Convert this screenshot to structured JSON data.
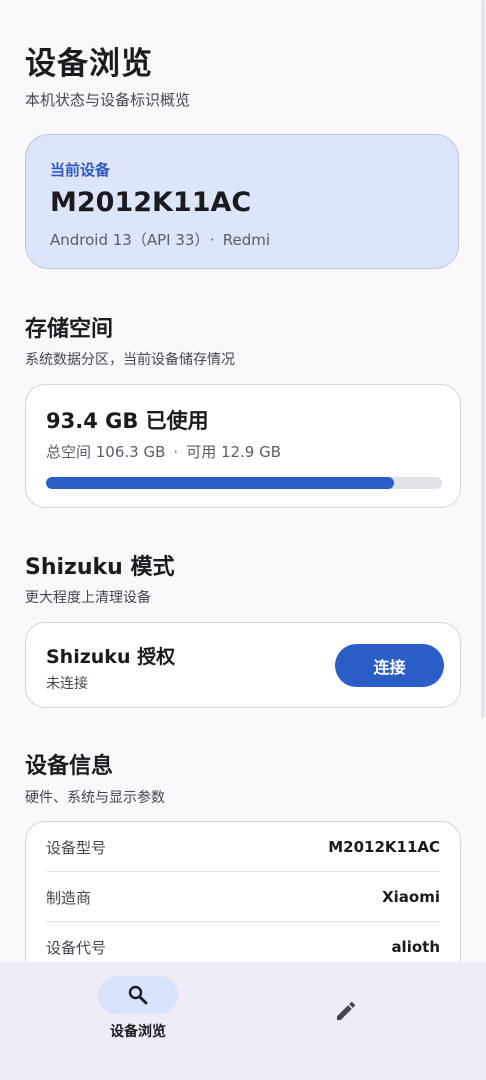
{
  "header": {
    "title": "设备浏览",
    "subtitle": "本机状态与设备标识概览"
  },
  "device_card": {
    "label": "当前设备",
    "model": "M2012K11AC",
    "os": "Android 13（API 33）",
    "separator": "·",
    "brand": "Redmi"
  },
  "storage": {
    "title": "存储空间",
    "subtitle": "系统数据分区，当前设备储存情况",
    "used": "93.4 GB 已使用",
    "total": "总空间 106.3 GB",
    "separator": "·",
    "free": "可用 12.9 GB",
    "used_fraction": 0.878
  },
  "shizuku": {
    "title": "Shizuku 模式",
    "subtitle": "更大程度上清理设备",
    "card_title": "Shizuku 授权",
    "status": "未连接",
    "button_label": "连接"
  },
  "device_info": {
    "title": "设备信息",
    "subtitle": "硬件、系统与显示参数",
    "rows": [
      {
        "key": "设备型号",
        "value": "M2012K11AC"
      },
      {
        "key": "制造商",
        "value": "Xiaomi"
      },
      {
        "key": "设备代号",
        "value": "alioth"
      }
    ]
  },
  "bottom_nav": {
    "items": [
      {
        "label": "设备浏览",
        "icon": "search-icon",
        "selected": true
      },
      {
        "label": "",
        "icon": "edit-icon",
        "selected": false
      }
    ]
  },
  "colors": {
    "accent": "#2a5dc6",
    "device_card_bg": "#dde5fb",
    "nav_bg": "#eeedf7",
    "nav_pill": "#d8e2fa"
  }
}
